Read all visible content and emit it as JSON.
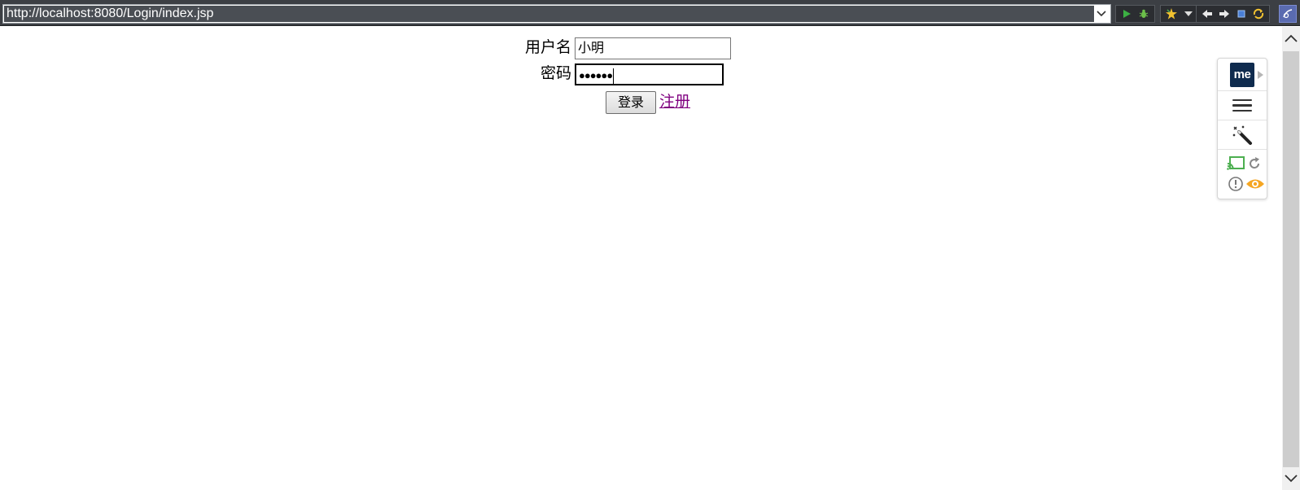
{
  "toolbar": {
    "url": "http://localhost:8080/Login/index.jsp"
  },
  "form": {
    "username_label": "用户名",
    "username_value": "小明",
    "password_label": "密码",
    "password_masked": "●●●●●●",
    "login_button": "登录",
    "register_link": "注册"
  },
  "side_panel": {
    "logo_text": "me"
  },
  "colors": {
    "toolbar_bg": "#3c3f44",
    "link_visited": "#800080",
    "logo_bg": "#0f2b4e",
    "cast_green": "#4caf50",
    "eye_orange": "#f5a623"
  }
}
